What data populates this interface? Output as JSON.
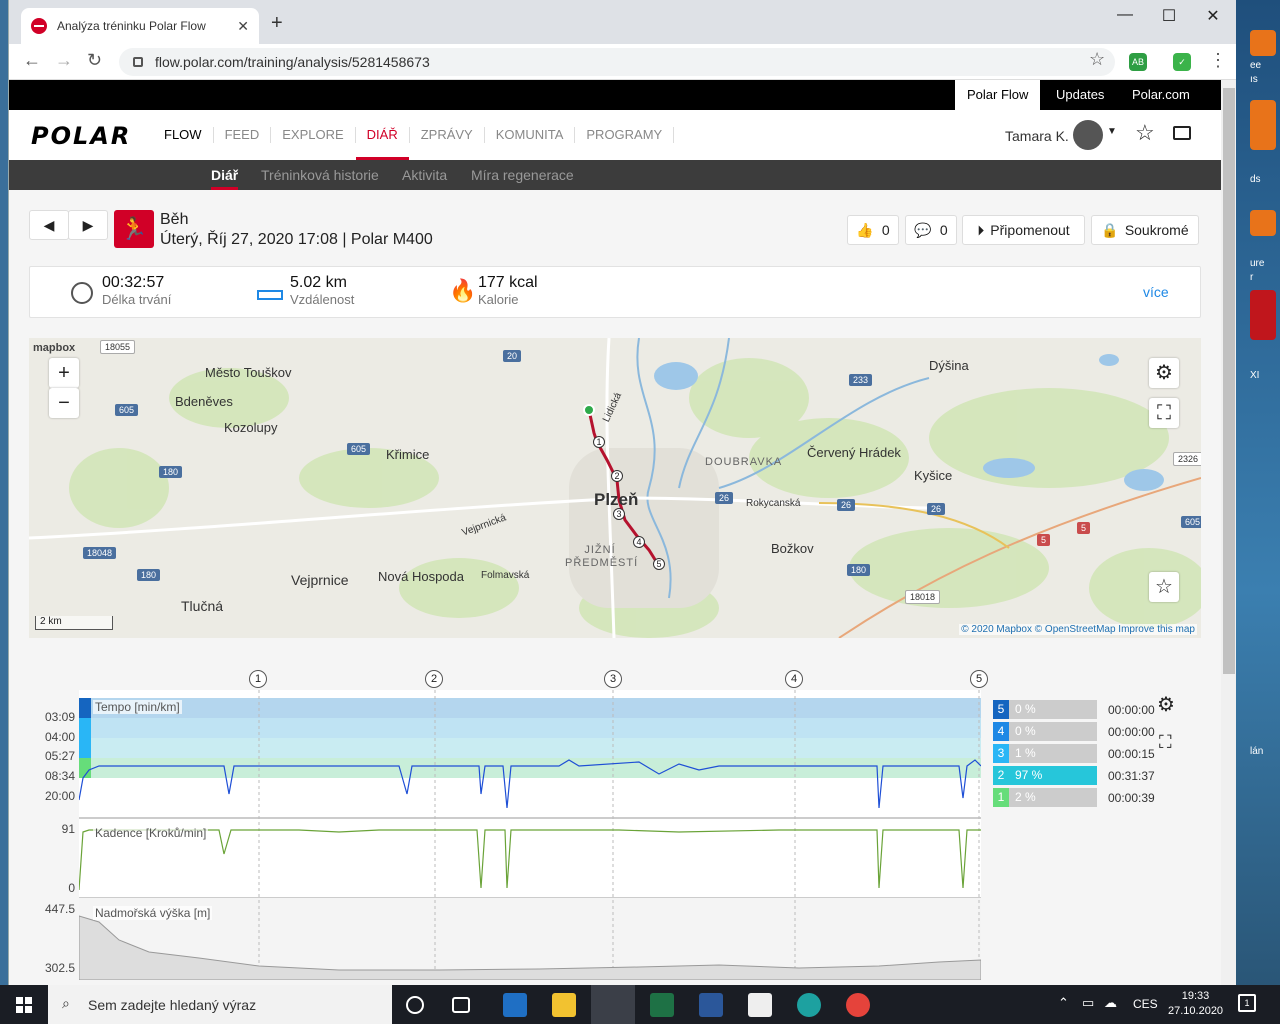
{
  "browser": {
    "tab_title": "Analýza tréninku Polar Flow",
    "url": "flow.polar.com/training/analysis/5281458673"
  },
  "polar": {
    "topstrip": [
      "Polar Flow",
      "Updates",
      "Polar.com"
    ],
    "logo": "POLAR",
    "nav": [
      "FLOW",
      "FEED",
      "EXPLORE",
      "DIÁŘ",
      "ZPRÁVY",
      "KOMUNITA",
      "PROGRAMY"
    ],
    "user": "Tamara K.",
    "subnav": [
      "Diář",
      "Tréninková historie",
      "Aktivita",
      "Míra regenerace"
    ]
  },
  "session": {
    "sport": "Běh",
    "datetime": "Úterý, Říj 27, 2020 17:08 | Polar M400",
    "likes": "0",
    "comments": "0",
    "remind": "Připomenout",
    "privacy": "Soukromé"
  },
  "summary": {
    "duration": "00:32:57",
    "duration_label": "Délka trvání",
    "distance": "5.02 km",
    "distance_label": "Vzdálenost",
    "calories": "177 kcal",
    "calories_label": "Kalorie",
    "more": "více"
  },
  "map": {
    "brand": "mapbox",
    "scale": "2 km",
    "attribution": "© 2020 Mapbox © OpenStreetMap Improve this map",
    "places": [
      "Město Touškov",
      "Bdeněves",
      "Kozolupy",
      "Křimice",
      "Plzeň",
      "Dýšina",
      "Červený Hrádek",
      "Kyšice",
      "DOUBRAVKA",
      "Rokycanská",
      "Božkov",
      "Vejprnice",
      "Nová Hospoda",
      "Folmavská",
      "Tlučná",
      "JIŽNÍ PŘEDMĚSTÍ",
      "Lidická",
      "Vejprnická"
    ],
    "roads": [
      "18055",
      "20",
      "605",
      "605",
      "180",
      "233",
      "2326",
      "26",
      "26",
      "26",
      "5",
      "5",
      "605",
      "18048",
      "180",
      "180",
      "18018",
      "5"
    ],
    "lap_markers": [
      "1",
      "2",
      "3",
      "4",
      "5"
    ]
  },
  "chart": {
    "lap_markers": [
      "1",
      "2",
      "3",
      "4",
      "5"
    ],
    "tempo_label": "Tempo [min/km]",
    "tempo_ticks": [
      "03:09",
      "04:00",
      "05:27",
      "08:34",
      "20:00"
    ],
    "cadence_label": "Kadence [Kroků/min]",
    "cadence_ticks": [
      "91",
      "0"
    ],
    "alt_label": "Nadmořská výška [m]",
    "alt_ticks": [
      "447.5",
      "302.5"
    ],
    "zones": [
      {
        "zone": "5",
        "pct": "0 %",
        "time": "00:00:00",
        "color": "#1565c0"
      },
      {
        "zone": "4",
        "pct": "0 %",
        "time": "00:00:00",
        "color": "#1e88e5"
      },
      {
        "zone": "3",
        "pct": "1 %",
        "time": "00:00:15",
        "color": "#29b6f6"
      },
      {
        "zone": "2",
        "pct": "97 %",
        "time": "00:31:37",
        "color": "#26c6da"
      },
      {
        "zone": "1",
        "pct": "2 %",
        "time": "00:00:39",
        "color": "#66dd7a"
      }
    ]
  },
  "taskbar": {
    "search": "Sem zadejte hledaný výraz",
    "lang": "CES",
    "time": "19:33",
    "date": "27.10.2020",
    "notif": "1"
  },
  "desktop": {
    "labels": [
      "ee",
      "ıs",
      "ds",
      "ure",
      "r",
      "XI",
      "lán"
    ]
  }
}
